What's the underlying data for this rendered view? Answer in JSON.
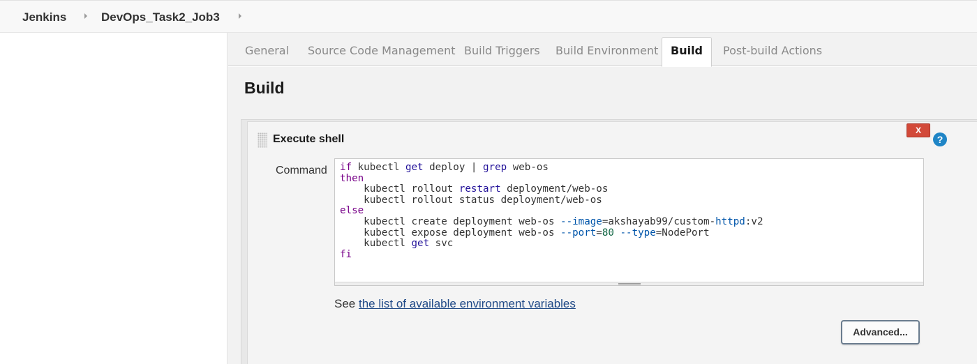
{
  "breadcrumb": {
    "items": [
      "Jenkins",
      "DevOps_Task2_Job3"
    ]
  },
  "tabs": [
    {
      "label": "General",
      "active": false
    },
    {
      "label": "Source Code Management",
      "active": false
    },
    {
      "label": "Build Triggers",
      "active": false
    },
    {
      "label": "Build Environment",
      "active": false
    },
    {
      "label": "Build",
      "active": true
    },
    {
      "label": "Post-build Actions",
      "active": false
    }
  ],
  "section": {
    "title": "Build"
  },
  "step": {
    "title": "Execute shell",
    "delete_label": "X",
    "help_label": "?",
    "command_label": "Command",
    "command_lines": [
      "if kubectl get deploy | grep web-os",
      "then",
      "    kubectl rollout restart deployment/web-os",
      "    kubectl rollout status deployment/web-os",
      "else",
      "    kubectl create deployment web-os --image=akshayab99/custom-httpd:v2",
      "    kubectl expose deployment web-os --port=80 --type=NodePort",
      "    kubectl get svc",
      "fi"
    ],
    "see_prefix": "See",
    "env_link": "the list of available environment variables",
    "advanced_label": "Advanced..."
  },
  "colors": {
    "keyword": "#770088",
    "builtin": "#221199",
    "variable": "#0055aa",
    "number": "#116644",
    "delete_button": "#d24939",
    "help_icon": "#1f85c6",
    "link": "#204a87"
  },
  "icons": {
    "breadcrumb_separator": "chevron-right-icon",
    "drag_handle": "drag-handle-icon",
    "help": "help-icon"
  }
}
